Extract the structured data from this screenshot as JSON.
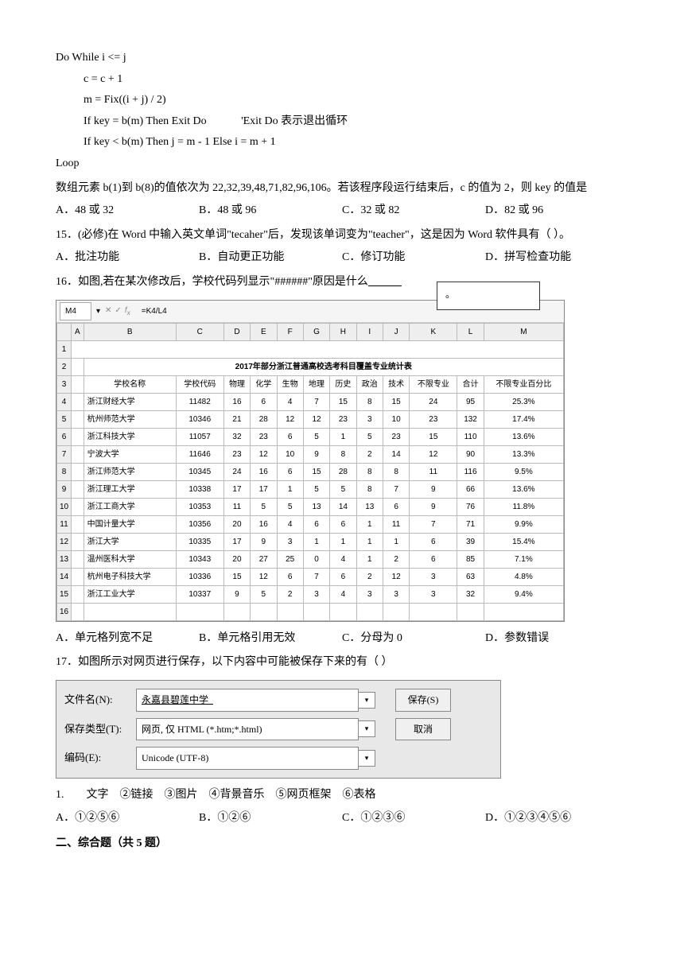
{
  "code": {
    "l1": "Do While i <= j",
    "l2": "c = c + 1",
    "l3": "m = Fix((i + j) / 2)",
    "l4": "If key = b(m) Then Exit Do",
    "l4_comment": "'Exit Do 表示退出循环",
    "l5": "If key < b(m) Then j = m - 1 Else i = m + 1",
    "l6": "Loop"
  },
  "q14": {
    "stem": "数组元素 b(1)到 b(8)的值依次为 22,32,39,48,71,82,96,106。若该程序段运行结束后，c 的值为 2，则 key 的值是",
    "A": "A．48 或 32",
    "B": "B．48 或 96",
    "C": "C．32 或 82",
    "D": "D．82 或 96"
  },
  "q15": {
    "stem": "15．(必修)在 Word 中输入英文单词\"tecaher\"后，发现该单词变为\"teacher\"，这是因为 Word 软件具有（  ）。",
    "A": "A．批注功能",
    "B": "B．自动更正功能",
    "C": "C．修订功能",
    "D": "D．拼写检查功能"
  },
  "q16": {
    "stem_pre": "16．如图,若在某次修改后，学校代码列显示\"######\"原因是什么",
    "blank": "            ",
    "A": "A．单元格列宽不足",
    "B": "B．单元格引用无效",
    "C": "C．分母为 0",
    "D": "D．参数错误"
  },
  "excel": {
    "active_cell": "M4",
    "formula": "=K4/L4",
    "callout": "。",
    "title": "2017年部分浙江普通高校选考科目覆盖专业统计表",
    "cols_alpha": [
      "A",
      "B",
      "C",
      "D",
      "E",
      "F",
      "G",
      "H",
      "I",
      "J",
      "K",
      "L",
      "M"
    ],
    "headers": [
      "",
      "学校名称",
      "学校代码",
      "物理",
      "化学",
      "生物",
      "地理",
      "历史",
      "政治",
      "技术",
      "不限专业",
      "合计",
      "不限专业百分比"
    ],
    "rows": [
      {
        "n": "4",
        "c": [
          "",
          "浙江财经大学",
          "11482",
          "16",
          "6",
          "4",
          "7",
          "15",
          "8",
          "15",
          "24",
          "95",
          "25.3%"
        ]
      },
      {
        "n": "5",
        "c": [
          "",
          "杭州师范大学",
          "10346",
          "21",
          "28",
          "12",
          "12",
          "23",
          "3",
          "10",
          "23",
          "132",
          "17.4%"
        ]
      },
      {
        "n": "6",
        "c": [
          "",
          "浙江科技大学",
          "11057",
          "32",
          "23",
          "6",
          "5",
          "1",
          "5",
          "23",
          "15",
          "110",
          "13.6%"
        ]
      },
      {
        "n": "7",
        "c": [
          "",
          "宁波大学",
          "11646",
          "23",
          "12",
          "10",
          "9",
          "8",
          "2",
          "14",
          "12",
          "90",
          "13.3%"
        ]
      },
      {
        "n": "8",
        "c": [
          "",
          "浙江师范大学",
          "10345",
          "24",
          "16",
          "6",
          "15",
          "28",
          "8",
          "8",
          "11",
          "116",
          "9.5%"
        ]
      },
      {
        "n": "9",
        "c": [
          "",
          "浙江理工大学",
          "10338",
          "17",
          "17",
          "1",
          "5",
          "5",
          "8",
          "7",
          "9",
          "66",
          "13.6%"
        ]
      },
      {
        "n": "10",
        "c": [
          "",
          "浙江工商大学",
          "10353",
          "11",
          "5",
          "5",
          "13",
          "14",
          "13",
          "6",
          "9",
          "76",
          "11.8%"
        ]
      },
      {
        "n": "11",
        "c": [
          "",
          "中国计量大学",
          "10356",
          "20",
          "16",
          "4",
          "6",
          "6",
          "1",
          "11",
          "7",
          "71",
          "9.9%"
        ]
      },
      {
        "n": "12",
        "c": [
          "",
          "浙江大学",
          "10335",
          "17",
          "9",
          "3",
          "1",
          "1",
          "1",
          "1",
          "6",
          "39",
          "15.4%"
        ]
      },
      {
        "n": "13",
        "c": [
          "",
          "温州医科大学",
          "10343",
          "20",
          "27",
          "25",
          "0",
          "4",
          "1",
          "2",
          "6",
          "85",
          "7.1%"
        ]
      },
      {
        "n": "14",
        "c": [
          "",
          "杭州电子科技大学",
          "10336",
          "15",
          "12",
          "6",
          "7",
          "6",
          "2",
          "12",
          "3",
          "63",
          "4.8%"
        ]
      },
      {
        "n": "15",
        "c": [
          "",
          "浙江工业大学",
          "10337",
          "9",
          "5",
          "2",
          "3",
          "4",
          "3",
          "3",
          "3",
          "32",
          "9.4%"
        ]
      },
      {
        "n": "16",
        "c": [
          "",
          "",
          "",
          "",
          "",
          "",
          "",
          "",
          "",
          "",
          "",
          "",
          ""
        ]
      }
    ]
  },
  "q17": {
    "stem": "17．如图所示对网页进行保存，以下内容中可能被保存下来的有（    ）",
    "dialog": {
      "label_filename": "文件名(N):",
      "val_filename": "永嘉县碧莲中学_",
      "label_type": "保存类型(T):",
      "val_type": "网页, 仅 HTML (*.htm;*.html)",
      "label_encoding": "编码(E):",
      "val_encoding": "Unicode (UTF-8)",
      "btn_save": "保存(S)",
      "btn_cancel": "取消"
    },
    "items": "1.        文字    ②链接    ③图片    ④背景音乐    ⑤网页框架    ⑥表格",
    "A": "A．①②⑤⑥",
    "B": "B．①②⑥",
    "C": "C．①②③⑥",
    "D": "D．①②③④⑤⑥"
  },
  "section2": "二、综合题（共 5 题）"
}
